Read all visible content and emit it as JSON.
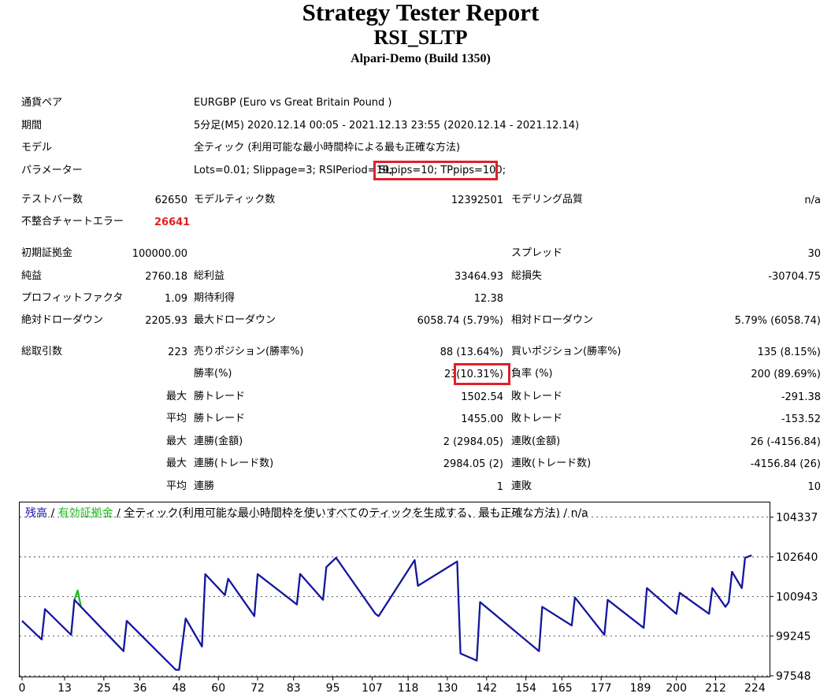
{
  "report": {
    "title": "Strategy Tester Report",
    "expert": "RSI_SLTP",
    "server": "Alpari-Demo (Build 1350)"
  },
  "info": {
    "symbol_label": "通貨ペア",
    "symbol_value": "EURGBP (Euro vs Great Britain Pound )",
    "period_label": "期間",
    "period_value": "5分足(M5) 2020.12.14 00:05 - 2021.12.13 23:55 (2020.12.14 - 2021.12.14)",
    "model_label": "モデル",
    "model_value": "全ティック (利用可能な最小時間枠による最も正確な方法)",
    "params_label": "パラメーター",
    "params_value_a": "Lots=0.01; Slippage=3; RSIPeriod=19;",
    "params_value_b": "SLpips=10; TPpips=100;"
  },
  "stats": {
    "bars_label": "テストバー数",
    "bars_value": "62650",
    "ticks_label": "モデルティック数",
    "ticks_value": "12392501",
    "quality_label": "モデリング品質",
    "quality_value": "n/a",
    "mismatch_label": "不整合チャートエラー",
    "mismatch_value": "26641",
    "deposit_label": "初期証拠金",
    "deposit_value": "100000.00",
    "spread_label": "スプレッド",
    "spread_value": "30",
    "net_label": "純益",
    "net_value": "2760.18",
    "gross_profit_label": "総利益",
    "gross_profit_value": "33464.93",
    "gross_loss_label": "総損失",
    "gross_loss_value": "-30704.75",
    "pf_label": "プロフィットファクタ",
    "pf_value": "1.09",
    "payoff_label": "期待利得",
    "payoff_value": "12.38",
    "abs_dd_label": "絶対ドローダウン",
    "abs_dd_value": "2205.93",
    "max_dd_label": "最大ドローダウン",
    "max_dd_value": "6058.74 (5.79%)",
    "rel_dd_label": "相対ドローダウン",
    "rel_dd_value": "5.79% (6058.74)",
    "trades_label": "総取引数",
    "trades_value": "223",
    "short_label": "売りポジション(勝率%)",
    "short_value": "88 (13.64%)",
    "long_label": "買いポジション(勝率%)",
    "long_value": "135 (8.15%)",
    "win_label": "勝率(%)",
    "win_value_a": "23",
    "win_value_b": "(10.31%)",
    "loss_label": "負率 (%)",
    "loss_value": "200 (89.69%)",
    "largest_label": "最大",
    "largest_win_label": "勝トレード",
    "largest_win_value": "1502.54",
    "largest_loss_label": "敗トレード",
    "largest_loss_value": "-291.38",
    "average_label": "平均",
    "average_win_label": "勝トレード",
    "average_win_value": "1455.00",
    "average_loss_label": "敗トレード",
    "average_loss_value": "-153.52",
    "max1_label": "最大",
    "max_cons_wins_money_label": "連勝(金額)",
    "max_cons_wins_money_value": "2 (2984.05)",
    "max_cons_losses_money_label": "連敗(金額)",
    "max_cons_losses_money_value": "26 (-4156.84)",
    "max2_label": "最大",
    "max_cons_profit_label": "連勝(トレード数)",
    "max_cons_profit_value": "2984.05 (2)",
    "max_cons_loss_label": "連敗(トレード数)",
    "max_cons_loss_value": "-4156.84 (26)",
    "avg2_label": "平均",
    "avg_cons_wins_label": "連勝",
    "avg_cons_wins_value": "1",
    "avg_cons_losses_label": "連敗",
    "avg_cons_losses_value": "10"
  },
  "chart_legend": {
    "balance": "残高",
    "sep1": " / ",
    "equity": "有効証拠金",
    "sep2": " / ",
    "desc": "全ティック(利用可能な最小時間枠を使いすべてのティックを生成する、最も正確な方法) / n/a"
  },
  "colors": {
    "balance": "#1a12a8",
    "equity": "#18b818",
    "highlight": "#e0202a",
    "mismatch": "#e02020"
  },
  "chart_data": {
    "type": "line",
    "xlabel": "",
    "ylabel": "",
    "xlim": [
      0,
      228
    ],
    "ylim": [
      97548,
      104900
    ],
    "x_ticks": [
      0,
      13,
      25,
      36,
      48,
      60,
      72,
      83,
      95,
      107,
      118,
      130,
      142,
      154,
      165,
      177,
      189,
      200,
      212,
      224
    ],
    "y_ticks": [
      97548,
      99245,
      100943,
      102640,
      104337
    ],
    "series": [
      {
        "name": "残高",
        "x": [
          0,
          6,
          7,
          15,
          16,
          18,
          31,
          32,
          47,
          48,
          50,
          55,
          56,
          62,
          63,
          71,
          72,
          84,
          85,
          92,
          93,
          96,
          108,
          109,
          120,
          121,
          133,
          134,
          139,
          140,
          158,
          159,
          168,
          169,
          178,
          179,
          190,
          191,
          200,
          201,
          210,
          211,
          215,
          216,
          217,
          220,
          221,
          222,
          223
        ],
        "y": [
          99900,
          99100,
          100400,
          99300,
          100800,
          100500,
          98600,
          99900,
          97800,
          97800,
          100000,
          98800,
          101900,
          101000,
          101700,
          100100,
          101900,
          100600,
          101910,
          100800,
          102200,
          102600,
          100200,
          100100,
          102500,
          101400,
          102440,
          98500,
          98200,
          100700,
          98600,
          100500,
          99700,
          100900,
          99300,
          100800,
          99600,
          101300,
          100200,
          101100,
          100200,
          101300,
          100500,
          100700,
          102000,
          101300,
          102600,
          102650,
          102700
        ]
      },
      {
        "name": "有効証拠金",
        "x": [
          0,
          6,
          7,
          15,
          16,
          17,
          18,
          31,
          32,
          47,
          48,
          50,
          55,
          56,
          62,
          63,
          71,
          72,
          84,
          85,
          92,
          93,
          96,
          108,
          109,
          120,
          121,
          133,
          134,
          139,
          140,
          158,
          159,
          168,
          169,
          178,
          179,
          190,
          191,
          200,
          201,
          210,
          211,
          215,
          216,
          217,
          220,
          221,
          222,
          223
        ],
        "y": [
          99900,
          99100,
          100400,
          99300,
          100800,
          101200,
          100500,
          98600,
          99900,
          97800,
          97800,
          100000,
          98800,
          101900,
          101000,
          101700,
          100100,
          101900,
          100600,
          101910,
          100800,
          102200,
          102600,
          100200,
          100100,
          102500,
          101400,
          102440,
          98500,
          98200,
          100700,
          98600,
          100500,
          99700,
          100900,
          99300,
          100800,
          99600,
          101300,
          100200,
          101100,
          100200,
          101300,
          100500,
          100700,
          102000,
          101300,
          102600,
          102650,
          102700
        ]
      }
    ]
  }
}
